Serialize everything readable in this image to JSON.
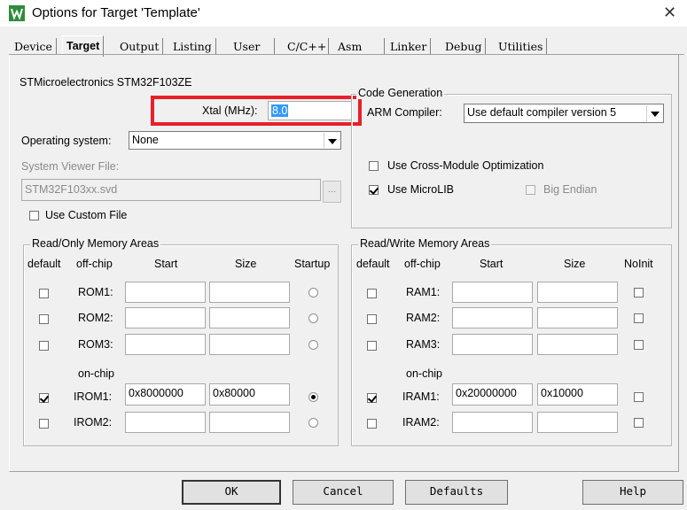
{
  "window": {
    "title": "Options for Target 'Template'"
  },
  "tabs": [
    {
      "label": "Device"
    },
    {
      "label": "Target"
    },
    {
      "label": "Output"
    },
    {
      "label": "Listing"
    },
    {
      "label": "User"
    },
    {
      "label": "C/C++"
    },
    {
      "label": "Asm"
    },
    {
      "label": "Linker"
    },
    {
      "label": "Debug"
    },
    {
      "label": "Utilities"
    }
  ],
  "device_name": "STMicroelectronics STM32F103ZE",
  "xtal": {
    "label": "Xtal (MHz):",
    "value": "8.0"
  },
  "os": {
    "label": "Operating system:",
    "value": "None"
  },
  "svd": {
    "label": "System Viewer File:",
    "value": "STM32F103xx.svd",
    "browse": "..."
  },
  "custom_file": {
    "label": "Use Custom File",
    "checked": false
  },
  "codegen": {
    "title": "Code Generation",
    "compiler_label": "ARM Compiler:",
    "compiler_value": "Use default compiler version 5",
    "cross_module": {
      "label": "Use Cross-Module Optimization",
      "checked": false
    },
    "microlib": {
      "label": "Use MicroLIB",
      "checked": true
    },
    "big_endian": {
      "label": "Big Endian",
      "checked": false
    }
  },
  "ro": {
    "title": "Read/Only Memory Areas",
    "headers": {
      "default": "default",
      "offchip": "off-chip",
      "start": "Start",
      "size": "Size",
      "startup": "Startup"
    },
    "onchip": "on-chip",
    "rows": [
      {
        "name": "ROM1:",
        "default": false,
        "start": "",
        "size": "",
        "startup": false
      },
      {
        "name": "ROM2:",
        "default": false,
        "start": "",
        "size": "",
        "startup": false
      },
      {
        "name": "ROM3:",
        "default": false,
        "start": "",
        "size": "",
        "startup": false
      },
      {
        "name": "IROM1:",
        "default": true,
        "start": "0x8000000",
        "size": "0x80000",
        "startup": true
      },
      {
        "name": "IROM2:",
        "default": false,
        "start": "",
        "size": "",
        "startup": false
      }
    ]
  },
  "rw": {
    "title": "Read/Write Memory Areas",
    "headers": {
      "default": "default",
      "offchip": "off-chip",
      "start": "Start",
      "size": "Size",
      "noinit": "NoInit"
    },
    "onchip": "on-chip",
    "rows": [
      {
        "name": "RAM1:",
        "default": false,
        "start": "",
        "size": "",
        "noinit": false
      },
      {
        "name": "RAM2:",
        "default": false,
        "start": "",
        "size": "",
        "noinit": false
      },
      {
        "name": "RAM3:",
        "default": false,
        "start": "",
        "size": "",
        "noinit": false
      },
      {
        "name": "IRAM1:",
        "default": true,
        "start": "0x20000000",
        "size": "0x10000",
        "noinit": false
      },
      {
        "name": "IRAM2:",
        "default": false,
        "start": "",
        "size": "",
        "noinit": false
      }
    ]
  },
  "buttons": {
    "ok": "OK",
    "cancel": "Cancel",
    "defaults": "Defaults",
    "help": "Help"
  }
}
